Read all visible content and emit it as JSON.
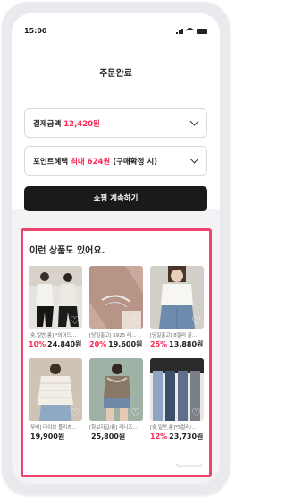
{
  "status_bar": {
    "time": "15:00"
  },
  "header": {
    "title": "주문완료"
  },
  "payment": {
    "label": "결제금액",
    "amount": "12,420원"
  },
  "points": {
    "label": "포인트혜택",
    "highlight": "최대 624원",
    "note": "(구매확정 시)"
  },
  "continue_button": {
    "label": "쇼핑 계속하기"
  },
  "recommendations": {
    "title": "이런 상품도 있어요.",
    "sponsored": "Sponsored",
    "products": [
      {
        "name": "[숏,일반,롱] *와이드…",
        "discount": "10%",
        "price": "24,840원"
      },
      {
        "name": "[당일출고] S925 레…",
        "discount": "20%",
        "price": "19,600원"
      },
      {
        "name": "[당일출고] 8컬러 골…",
        "discount": "25%",
        "price": "13,880원"
      },
      {
        "name": "[무배] 다이브 플리츠…",
        "discount": "",
        "price": "19,900원"
      },
      {
        "name": "[화보지급/롱] 레니즈…",
        "discount": "",
        "price": "25,800원"
      },
      {
        "name": "[숏,일반,롱]*5컬러/…",
        "discount": "12%",
        "price": "23,730원"
      }
    ]
  },
  "colors": {
    "accent": "#ff2857",
    "highlight_border": "#f0426d",
    "button": "#1a1a1a"
  }
}
